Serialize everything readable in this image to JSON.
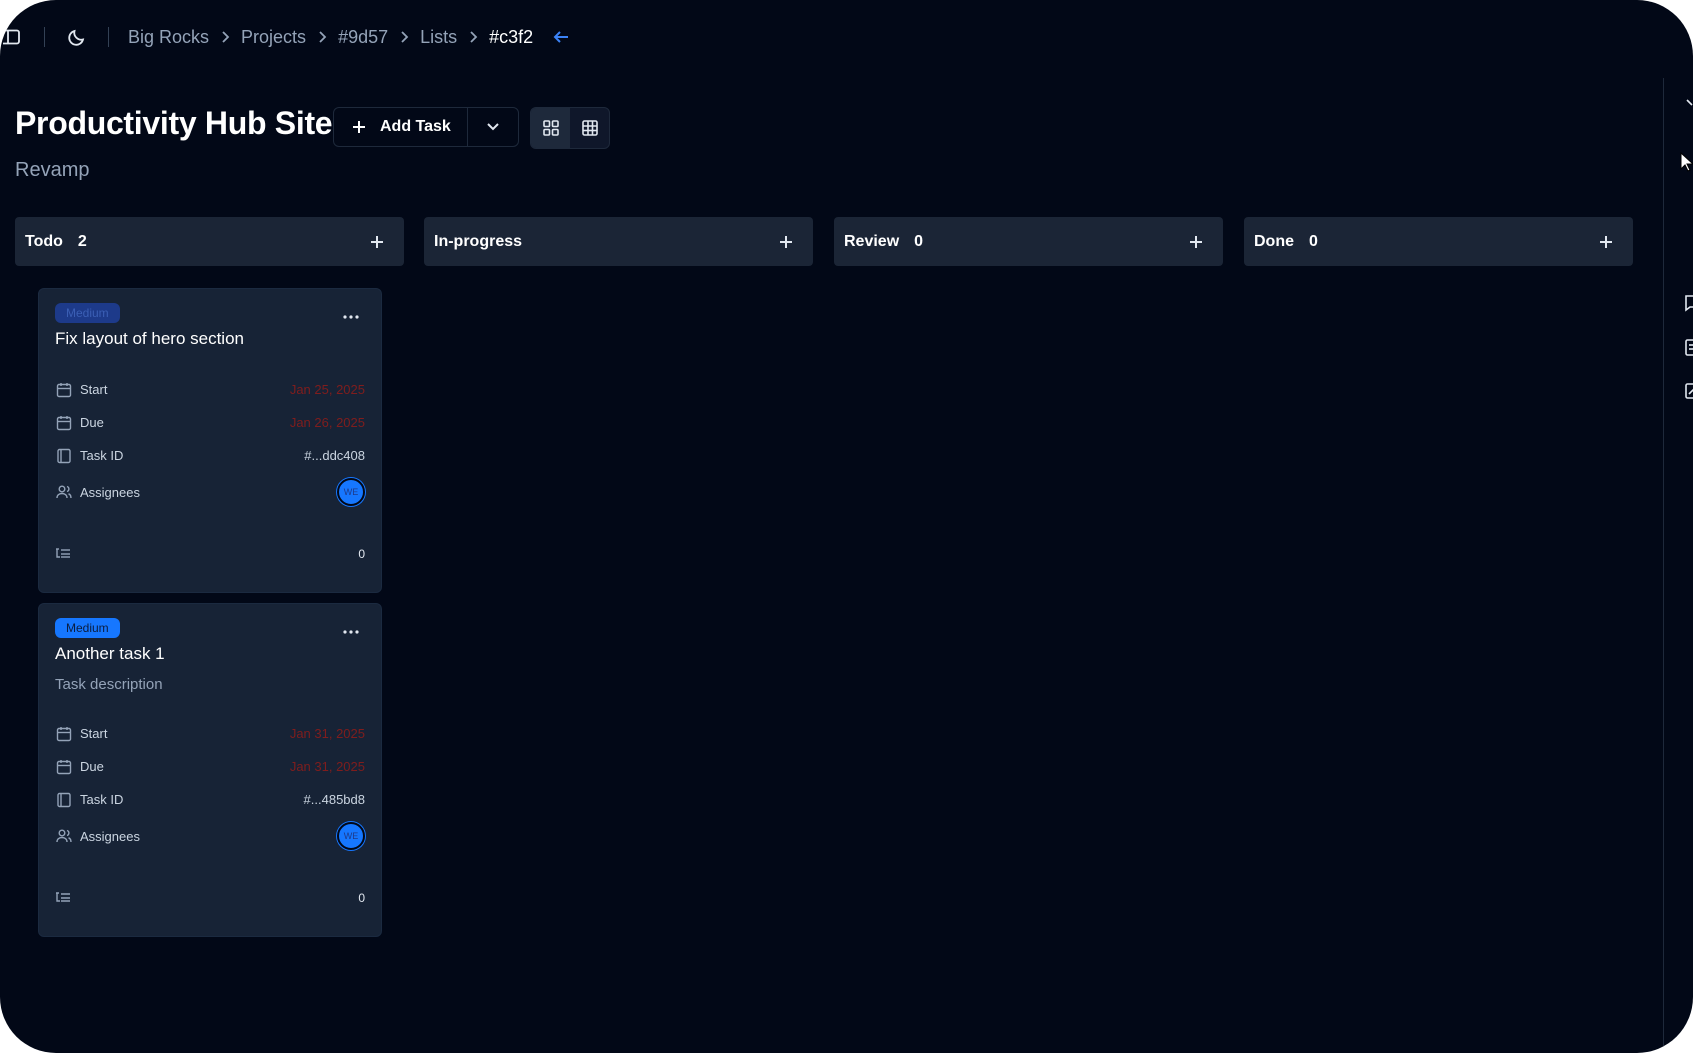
{
  "breadcrumb": [
    "Big Rocks",
    "Projects",
    "#9d57",
    "Lists",
    "#c3f2"
  ],
  "page": {
    "title": "Productivity Hub Site",
    "subtitle": "Revamp"
  },
  "toolbar": {
    "add_task_label": "Add Task"
  },
  "columns": [
    {
      "name": "Todo",
      "count": "2"
    },
    {
      "name": "In-progress",
      "count": ""
    },
    {
      "name": "Review",
      "count": "0"
    },
    {
      "name": "Done",
      "count": "0"
    }
  ],
  "cards": [
    {
      "priority": "Medium",
      "title": "Fix layout of hero section",
      "description": "",
      "start_label": "Start",
      "start": "Jan 25, 2025",
      "due_label": "Due",
      "due": "Jan 26, 2025",
      "task_id_label": "Task ID",
      "task_id": "#...ddc408",
      "assignees_label": "Assignees",
      "assignee_initials": "WE",
      "subtask_count": "0"
    },
    {
      "priority": "Medium",
      "title": "Another task 1",
      "description": "Task description",
      "start_label": "Start",
      "start": "Jan 31, 2025",
      "due_label": "Due",
      "due": "Jan 31, 2025",
      "task_id_label": "Task ID",
      "task_id": "#...485bd8",
      "assignees_label": "Assignees",
      "assignee_initials": "WE",
      "subtask_count": "0"
    }
  ],
  "icons": {
    "sidebar_toggle": "sidebar-icon",
    "theme": "moon-icon",
    "back": "arrow-left-icon",
    "grid_view": "grid-icon",
    "table_view": "table-icon"
  },
  "colors": {
    "background": "#020817",
    "column_header": "#1b2536",
    "card": "#172336",
    "accent": "#1677ff",
    "overdue": "#7f1d1d"
  }
}
